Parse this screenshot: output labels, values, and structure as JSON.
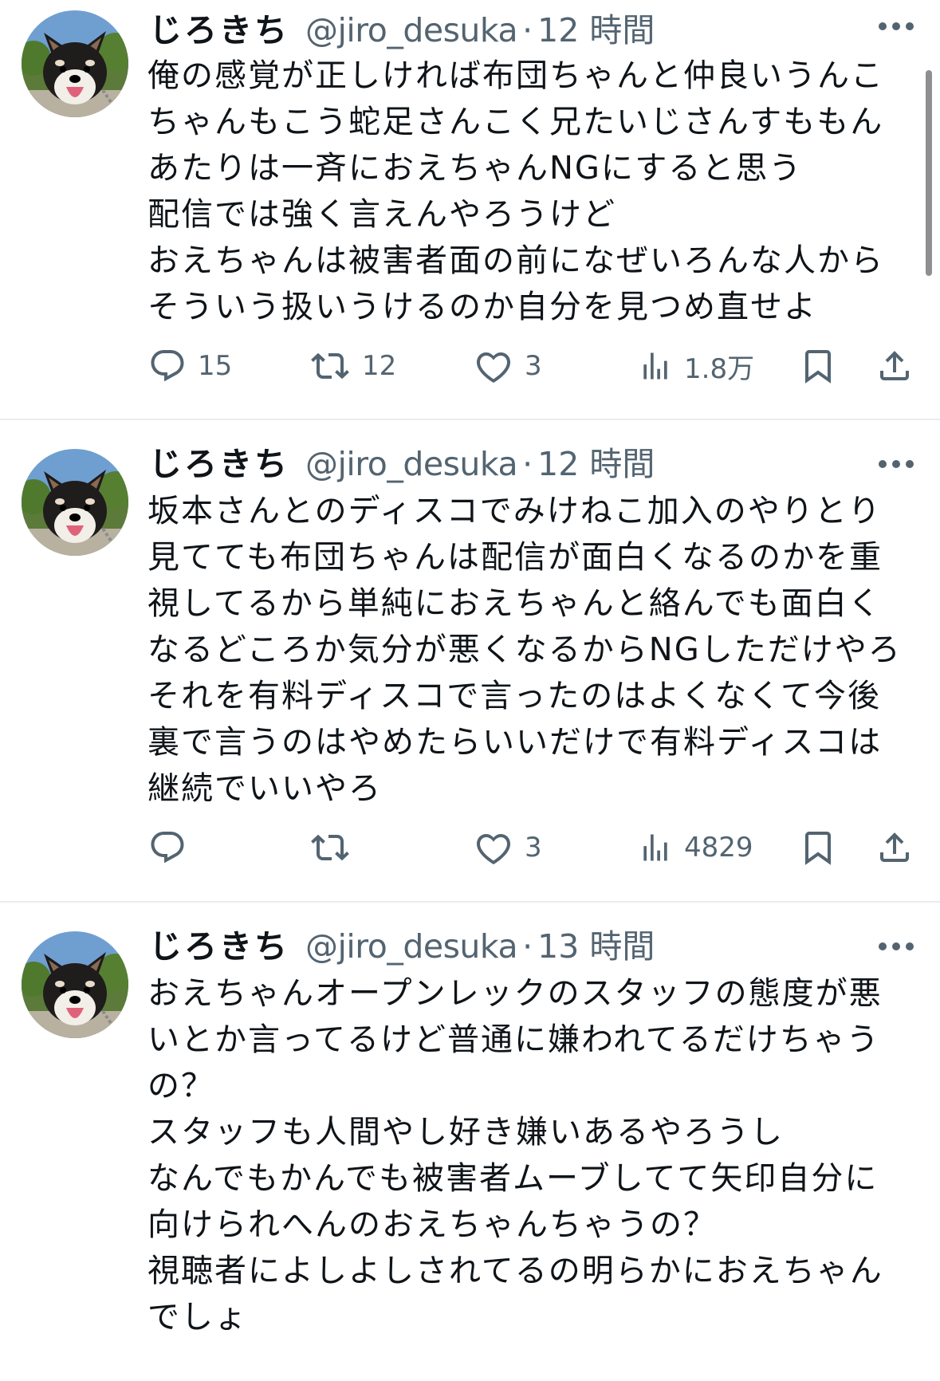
{
  "tweets": [
    {
      "name": "じろきち",
      "handle": "@jiro_desuka",
      "separator": "·",
      "time": "12 時間",
      "text": "俺の感覚が正しければ布団ちゃんと仲良いうんこ\nちゃんもこう蛇足さんこく兄たいじさんすももん\nあたりは一斉におえちゃんNGにすると思う\n配信では強く言えんやろうけど\nおえちゃんは被害者面の前になぜいろんな人から\nそういう扱いうけるのか自分を見つめ直せよ",
      "replies": "15",
      "retweets": "12",
      "likes": "3",
      "views": "1.8万"
    },
    {
      "name": "じろきち",
      "handle": "@jiro_desuka",
      "separator": "·",
      "time": "12 時間",
      "text": "坂本さんとのディスコでみけねこ加入のやりとり\n見てても布団ちゃんは配信が面白くなるのかを重\n視してるから単純におえちゃんと絡んでも面白く\nなるどころか気分が悪くなるからNGしただけやろ\nそれを有料ディスコで言ったのはよくなくて今後\n裏で言うのはやめたらいいだけで有料ディスコは\n継続でいいやろ",
      "replies": "",
      "retweets": "",
      "likes": "3",
      "views": "4829"
    },
    {
      "name": "じろきち",
      "handle": "@jiro_desuka",
      "separator": "·",
      "time": "13 時間",
      "text": "おえちゃんオープンレックのスタッフの態度が悪\nいとか言ってるけど普通に嫌われてるだけちゃう\nの？\nスタッフも人間やし好き嫌いあるやろうし\nなんでもかんでも被害者ムーブしてて矢印自分に\n向けられへんのおえちゃんちゃうの？\n視聴者によしよしされてるの明らかにおえちゃん\nでしょ",
      "replies": "",
      "retweets": "",
      "likes": "",
      "views": ""
    }
  ],
  "icons": [
    "avatar-shiba-dog",
    "more-icon",
    "reply-icon",
    "retweet-icon",
    "like-icon",
    "views-icon",
    "bookmark-icon",
    "share-icon"
  ],
  "colors": {
    "text": "#0f1419",
    "secondary": "#536471",
    "divider": "#e9ecef",
    "background": "#ffffff"
  }
}
